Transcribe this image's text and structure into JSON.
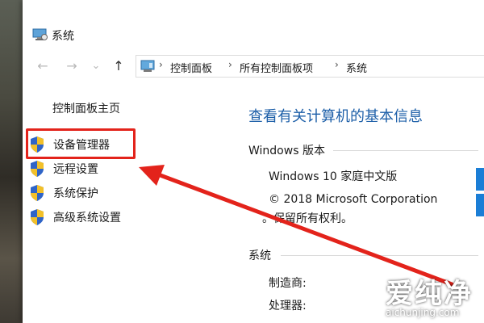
{
  "window": {
    "title": "系统",
    "title_icon": "computer-settings-icon"
  },
  "nav": {
    "back_icon": "←",
    "forward_icon": "→",
    "recent_icon": "⌄",
    "up_icon": "↑",
    "breadcrumbs": [
      "控制面板",
      "所有控制面板项",
      "系统"
    ],
    "separator": "›"
  },
  "sidebar": {
    "home": "控制面板主页",
    "items": [
      {
        "label": "设备管理器",
        "icon": "shield-icon"
      },
      {
        "label": "远程设置",
        "icon": "shield-icon"
      },
      {
        "label": "系统保护",
        "icon": "shield-icon"
      },
      {
        "label": "高级系统设置",
        "icon": "shield-icon"
      }
    ]
  },
  "main": {
    "heading": "查看有关计算机的基本信息",
    "windows_section": {
      "title": "Windows 版本",
      "edition": "Windows 10 家庭中文版",
      "copyright": "© 2018 Microsoft Corporation",
      "rights": "。保留所有权利。"
    },
    "system_section": {
      "title": "系统",
      "manufacturer_label": "制造商:",
      "processor_label": "处理器:"
    }
  },
  "watermark": {
    "title": "爱纯净",
    "url": "aichunjing.com"
  },
  "colors": {
    "accent": "#1d5fa8",
    "highlight": "#e3231b",
    "arrow": "#e3231b"
  }
}
